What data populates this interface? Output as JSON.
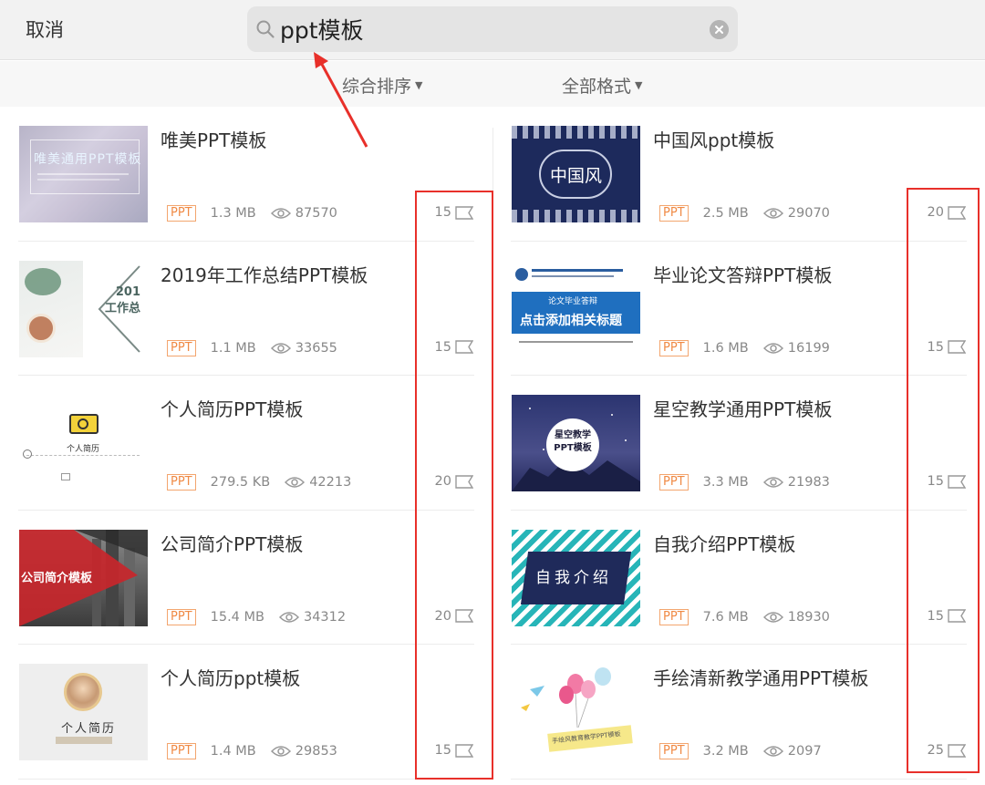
{
  "header": {
    "cancel_label": "取消",
    "search_value": "ppt模板"
  },
  "filters": {
    "sort_label": "综合排序",
    "format_label": "全部格式"
  },
  "colors": {
    "accent": "#f08a45",
    "annotation": "#e8302a"
  },
  "items": [
    {
      "title": "唯美PPT模板",
      "format": "PPT",
      "size": "1.3 MB",
      "views": "87570",
      "count": "15",
      "thumb_text": "唯美通用PPT模板"
    },
    {
      "title": "中国风ppt模板",
      "format": "PPT",
      "size": "2.5 MB",
      "views": "29070",
      "count": "20",
      "thumb_text": "中国风"
    },
    {
      "title": "2019年工作总结PPT模板",
      "format": "PPT",
      "size": "1.1 MB",
      "views": "33655",
      "count": "15",
      "thumb_text": "201\n工作总"
    },
    {
      "title": "毕业论文答辩PPT模板",
      "format": "PPT",
      "size": "1.6 MB",
      "views": "16199",
      "count": "15",
      "thumb_text": "点击添加相关标题",
      "thumb_subtext": "论文毕业答辩"
    },
    {
      "title": "个人简历PPT模板",
      "format": "PPT",
      "size": "279.5 KB",
      "views": "42213",
      "count": "20",
      "thumb_text": "个人简历"
    },
    {
      "title": "星空教学通用PPT模板",
      "format": "PPT",
      "size": "3.3 MB",
      "views": "21983",
      "count": "15",
      "thumb_text": "星空教学\nPPT模板"
    },
    {
      "title": "公司简介PPT模板",
      "format": "PPT",
      "size": "15.4 MB",
      "views": "34312",
      "count": "20",
      "thumb_text": "公司简介模板"
    },
    {
      "title": "自我介绍PPT模板",
      "format": "PPT",
      "size": "7.6 MB",
      "views": "18930",
      "count": "15",
      "thumb_text": "自我介绍"
    },
    {
      "title": "个人简历ppt模板",
      "format": "PPT",
      "size": "1.4 MB",
      "views": "29853",
      "count": "15",
      "thumb_text": "个人简历"
    },
    {
      "title": "手绘清新教学通用PPT模板",
      "format": "PPT",
      "size": "3.2 MB",
      "views": "2097",
      "count": "25",
      "thumb_text": "手绘风教育教学PPT模板"
    }
  ]
}
